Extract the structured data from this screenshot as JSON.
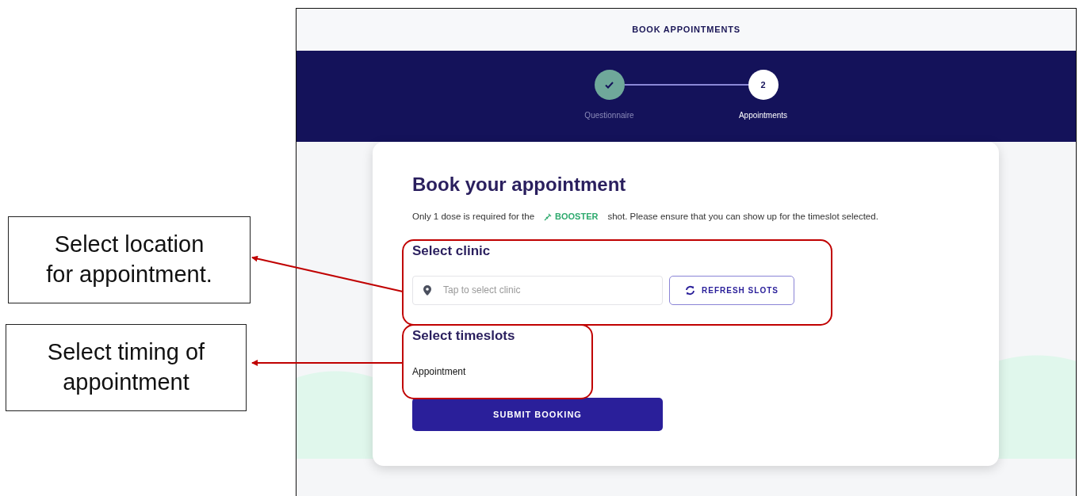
{
  "header": {
    "title": "BOOK APPOINTMENTS"
  },
  "steps": [
    {
      "label": "Questionnaire",
      "done": true,
      "selected": false
    },
    {
      "label": "Appointments",
      "number": "2",
      "done": false,
      "selected": true
    }
  ],
  "card": {
    "title": "Book your appointment",
    "intro": {
      "before": "Only 1 dose is required for the",
      "tag": "BOOSTER",
      "after": "shot. Please ensure that you can show up for the timeslot selected."
    },
    "clinic_section": {
      "title": "Select clinic",
      "field": {
        "placeholder": "Tap to select clinic"
      },
      "refresh_button": "REFRESH SLOTS"
    },
    "timeslot_section": {
      "title": "Select timeslots",
      "label": "Appointment"
    },
    "submit_button": "SUBMIT BOOKING"
  },
  "annotations": [
    {
      "text": "Select location\nfor appointment."
    },
    {
      "text": "Select timing of\nappointment"
    }
  ]
}
